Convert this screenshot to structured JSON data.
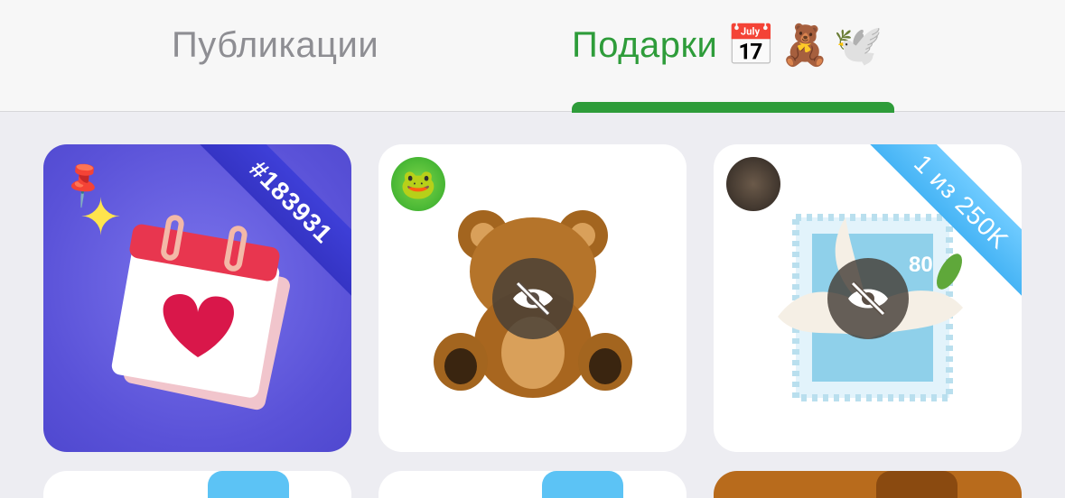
{
  "tabs": {
    "publications_label": "Публикации",
    "gifts_label": "Подарки",
    "gifts_icons": [
      "📅",
      "🧸",
      "🕊️"
    ]
  },
  "gifts": [
    {
      "ribbon": "#183931",
      "pinned": true,
      "art": "calendar-heart",
      "hidden": false
    },
    {
      "ribbon": "",
      "art": "teddy-bear",
      "hidden": true,
      "sender": "green-avatar"
    },
    {
      "ribbon": "1 из 250K",
      "art": "dove-stamp",
      "hidden": true,
      "sender": "photo-avatar"
    }
  ],
  "colors": {
    "accent": "#2e9c3a",
    "card1_bg": "#5a52d8",
    "ribbon_dark": "#3534c4",
    "ribbon_light": "#46b4f5"
  }
}
